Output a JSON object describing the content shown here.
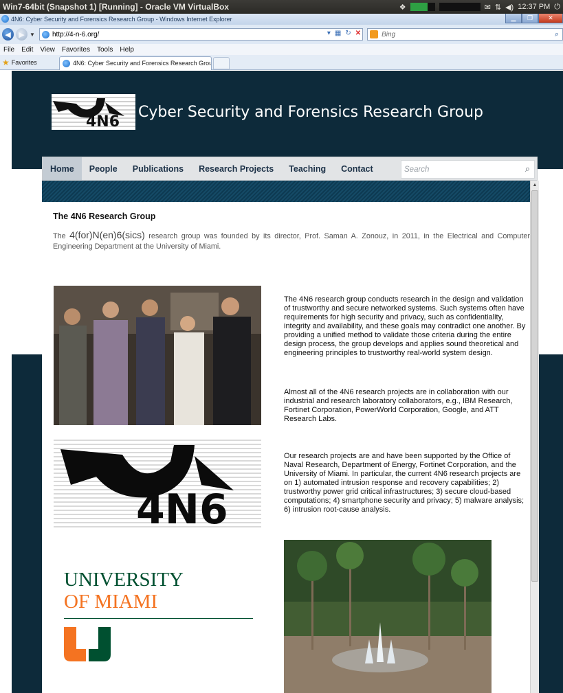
{
  "vbox": {
    "title": "Win7-64bit (Snapshot 1) [Running] - Oracle VM VirtualBox",
    "clock": "12:37 PM"
  },
  "ie": {
    "window_title": "4N6: Cyber Security and Forensics Research Group - Windows Internet Explorer",
    "url": "http://4-n-6.org/",
    "search_engine": "Bing",
    "menu": [
      "File",
      "Edit",
      "View",
      "Favorites",
      "Tools",
      "Help"
    ],
    "favorites_label": "Favorites",
    "tab_title": "4N6: Cyber Security and Forensics Research Group"
  },
  "site": {
    "logo_text": "4N6",
    "title": "Cyber Security and Forensics Research Group",
    "nav": [
      "Home",
      "People",
      "Publications",
      "Research Projects",
      "Teaching",
      "Contact"
    ],
    "active_nav": "Home",
    "search_placeholder": "Search"
  },
  "content": {
    "heading": "The 4N6 Research Group",
    "intro_pre": "The",
    "intro_big": "4(for)N(en)6(sics)",
    "intro_post": "research group was founded by its director, Prof. Saman A. Zonouz, in 2011, in the Electrical and Computer Engineering Department at the University of Miami.",
    "para1": "The 4N6 research group conducts research in the design and validation of trustworthy and secure networked systems. Such systems often have requirements for high security and privacy, such as confidentiality, integrity and availability, and these goals may contradict one another. By providing a unified method to validate those criteria during the entire design process, the group develops and applies sound theoretical and engineering principles to trustworthy real-world system design.",
    "para2": "Almost all of the 4N6 research projects are in collaboration with our industrial and research laboratory collaborators, e.g., IBM Research, Fortinet Corporation, PowerWorld Corporation, Google, and ATT Research Labs.",
    "para3": "Our research projects are and have been supported by the Office of Naval Research, Department of Energy, Fortinet Corporation, and the University of Miami. In particular, the current 4N6 research projects are on 1) automated intrusion response and recovery capabilities; 2) trustworthy power grid critical infrastructures; 3) secure cloud-based computations; 4) smartphone security and privacy; 5) malware analysis; 6) intrusion root-cause analysis.",
    "um_line1": "UNIVERSITY",
    "um_line2": "OF MIAMI"
  },
  "colors": {
    "header_bg": "#0d2a3a",
    "nav_bg": "#e2e4e6",
    "um_green": "#005030",
    "um_orange": "#f47321"
  }
}
